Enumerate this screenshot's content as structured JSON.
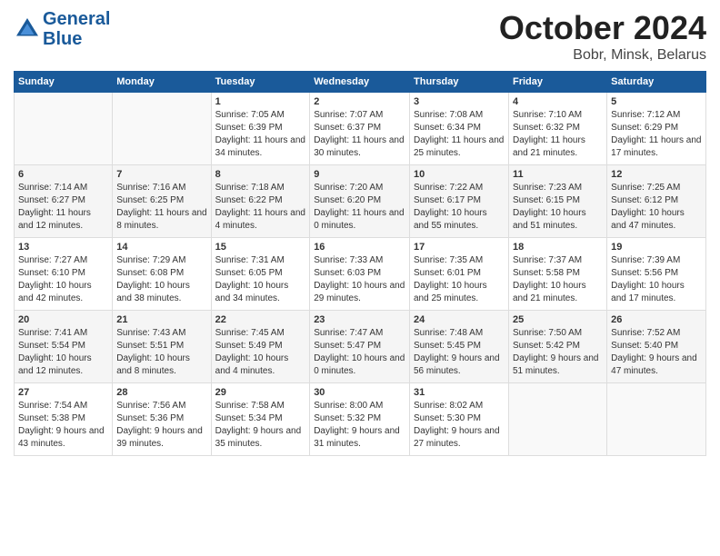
{
  "header": {
    "logo_line1": "General",
    "logo_line2": "Blue",
    "month": "October 2024",
    "location": "Bobr, Minsk, Belarus"
  },
  "weekdays": [
    "Sunday",
    "Monday",
    "Tuesday",
    "Wednesday",
    "Thursday",
    "Friday",
    "Saturday"
  ],
  "weeks": [
    [
      {
        "day": "",
        "sunrise": "",
        "sunset": "",
        "daylight": ""
      },
      {
        "day": "",
        "sunrise": "",
        "sunset": "",
        "daylight": ""
      },
      {
        "day": "1",
        "sunrise": "Sunrise: 7:05 AM",
        "sunset": "Sunset: 6:39 PM",
        "daylight": "Daylight: 11 hours and 34 minutes."
      },
      {
        "day": "2",
        "sunrise": "Sunrise: 7:07 AM",
        "sunset": "Sunset: 6:37 PM",
        "daylight": "Daylight: 11 hours and 30 minutes."
      },
      {
        "day": "3",
        "sunrise": "Sunrise: 7:08 AM",
        "sunset": "Sunset: 6:34 PM",
        "daylight": "Daylight: 11 hours and 25 minutes."
      },
      {
        "day": "4",
        "sunrise": "Sunrise: 7:10 AM",
        "sunset": "Sunset: 6:32 PM",
        "daylight": "Daylight: 11 hours and 21 minutes."
      },
      {
        "day": "5",
        "sunrise": "Sunrise: 7:12 AM",
        "sunset": "Sunset: 6:29 PM",
        "daylight": "Daylight: 11 hours and 17 minutes."
      }
    ],
    [
      {
        "day": "6",
        "sunrise": "Sunrise: 7:14 AM",
        "sunset": "Sunset: 6:27 PM",
        "daylight": "Daylight: 11 hours and 12 minutes."
      },
      {
        "day": "7",
        "sunrise": "Sunrise: 7:16 AM",
        "sunset": "Sunset: 6:25 PM",
        "daylight": "Daylight: 11 hours and 8 minutes."
      },
      {
        "day": "8",
        "sunrise": "Sunrise: 7:18 AM",
        "sunset": "Sunset: 6:22 PM",
        "daylight": "Daylight: 11 hours and 4 minutes."
      },
      {
        "day": "9",
        "sunrise": "Sunrise: 7:20 AM",
        "sunset": "Sunset: 6:20 PM",
        "daylight": "Daylight: 11 hours and 0 minutes."
      },
      {
        "day": "10",
        "sunrise": "Sunrise: 7:22 AM",
        "sunset": "Sunset: 6:17 PM",
        "daylight": "Daylight: 10 hours and 55 minutes."
      },
      {
        "day": "11",
        "sunrise": "Sunrise: 7:23 AM",
        "sunset": "Sunset: 6:15 PM",
        "daylight": "Daylight: 10 hours and 51 minutes."
      },
      {
        "day": "12",
        "sunrise": "Sunrise: 7:25 AM",
        "sunset": "Sunset: 6:12 PM",
        "daylight": "Daylight: 10 hours and 47 minutes."
      }
    ],
    [
      {
        "day": "13",
        "sunrise": "Sunrise: 7:27 AM",
        "sunset": "Sunset: 6:10 PM",
        "daylight": "Daylight: 10 hours and 42 minutes."
      },
      {
        "day": "14",
        "sunrise": "Sunrise: 7:29 AM",
        "sunset": "Sunset: 6:08 PM",
        "daylight": "Daylight: 10 hours and 38 minutes."
      },
      {
        "day": "15",
        "sunrise": "Sunrise: 7:31 AM",
        "sunset": "Sunset: 6:05 PM",
        "daylight": "Daylight: 10 hours and 34 minutes."
      },
      {
        "day": "16",
        "sunrise": "Sunrise: 7:33 AM",
        "sunset": "Sunset: 6:03 PM",
        "daylight": "Daylight: 10 hours and 29 minutes."
      },
      {
        "day": "17",
        "sunrise": "Sunrise: 7:35 AM",
        "sunset": "Sunset: 6:01 PM",
        "daylight": "Daylight: 10 hours and 25 minutes."
      },
      {
        "day": "18",
        "sunrise": "Sunrise: 7:37 AM",
        "sunset": "Sunset: 5:58 PM",
        "daylight": "Daylight: 10 hours and 21 minutes."
      },
      {
        "day": "19",
        "sunrise": "Sunrise: 7:39 AM",
        "sunset": "Sunset: 5:56 PM",
        "daylight": "Daylight: 10 hours and 17 minutes."
      }
    ],
    [
      {
        "day": "20",
        "sunrise": "Sunrise: 7:41 AM",
        "sunset": "Sunset: 5:54 PM",
        "daylight": "Daylight: 10 hours and 12 minutes."
      },
      {
        "day": "21",
        "sunrise": "Sunrise: 7:43 AM",
        "sunset": "Sunset: 5:51 PM",
        "daylight": "Daylight: 10 hours and 8 minutes."
      },
      {
        "day": "22",
        "sunrise": "Sunrise: 7:45 AM",
        "sunset": "Sunset: 5:49 PM",
        "daylight": "Daylight: 10 hours and 4 minutes."
      },
      {
        "day": "23",
        "sunrise": "Sunrise: 7:47 AM",
        "sunset": "Sunset: 5:47 PM",
        "daylight": "Daylight: 10 hours and 0 minutes."
      },
      {
        "day": "24",
        "sunrise": "Sunrise: 7:48 AM",
        "sunset": "Sunset: 5:45 PM",
        "daylight": "Daylight: 9 hours and 56 minutes."
      },
      {
        "day": "25",
        "sunrise": "Sunrise: 7:50 AM",
        "sunset": "Sunset: 5:42 PM",
        "daylight": "Daylight: 9 hours and 51 minutes."
      },
      {
        "day": "26",
        "sunrise": "Sunrise: 7:52 AM",
        "sunset": "Sunset: 5:40 PM",
        "daylight": "Daylight: 9 hours and 47 minutes."
      }
    ],
    [
      {
        "day": "27",
        "sunrise": "Sunrise: 7:54 AM",
        "sunset": "Sunset: 5:38 PM",
        "daylight": "Daylight: 9 hours and 43 minutes."
      },
      {
        "day": "28",
        "sunrise": "Sunrise: 7:56 AM",
        "sunset": "Sunset: 5:36 PM",
        "daylight": "Daylight: 9 hours and 39 minutes."
      },
      {
        "day": "29",
        "sunrise": "Sunrise: 7:58 AM",
        "sunset": "Sunset: 5:34 PM",
        "daylight": "Daylight: 9 hours and 35 minutes."
      },
      {
        "day": "30",
        "sunrise": "Sunrise: 8:00 AM",
        "sunset": "Sunset: 5:32 PM",
        "daylight": "Daylight: 9 hours and 31 minutes."
      },
      {
        "day": "31",
        "sunrise": "Sunrise: 8:02 AM",
        "sunset": "Sunset: 5:30 PM",
        "daylight": "Daylight: 9 hours and 27 minutes."
      },
      {
        "day": "",
        "sunrise": "",
        "sunset": "",
        "daylight": ""
      },
      {
        "day": "",
        "sunrise": "",
        "sunset": "",
        "daylight": ""
      }
    ]
  ]
}
